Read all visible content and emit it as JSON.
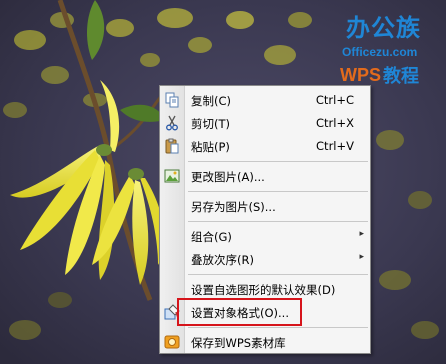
{
  "watermark": {
    "brand": "办公族",
    "site": "Officezu.com",
    "wps": "WPS",
    "tutorial": "教程"
  },
  "context_menu": {
    "items": [
      {
        "label": "复制(C)",
        "shortcut": "Ctrl+C",
        "icon": "copy-icon"
      },
      {
        "label": "剪切(T)",
        "shortcut": "Ctrl+X",
        "icon": "scissors-icon"
      },
      {
        "label": "粘贴(P)",
        "shortcut": "Ctrl+V",
        "icon": "paste-icon"
      },
      {
        "label": "更改图片(A)...",
        "icon": "change-picture-icon"
      },
      {
        "label": "另存为图片(S)..."
      },
      {
        "label": "组合(G)",
        "has_submenu": true
      },
      {
        "label": "叠放次序(R)",
        "has_submenu": true
      },
      {
        "label": "设置自选图形的默认效果(D)"
      },
      {
        "label": "设置对象格式(O)...",
        "icon": "format-object-icon",
        "highlighted": true
      },
      {
        "label": "保存到WPS素材库",
        "icon": "wps-library-icon"
      }
    ],
    "submenu_arrow": "▸"
  },
  "colors": {
    "highlight_box": "#d6141b",
    "logo_blue": "#1f86d6",
    "logo_orange": "#e36b1c"
  }
}
